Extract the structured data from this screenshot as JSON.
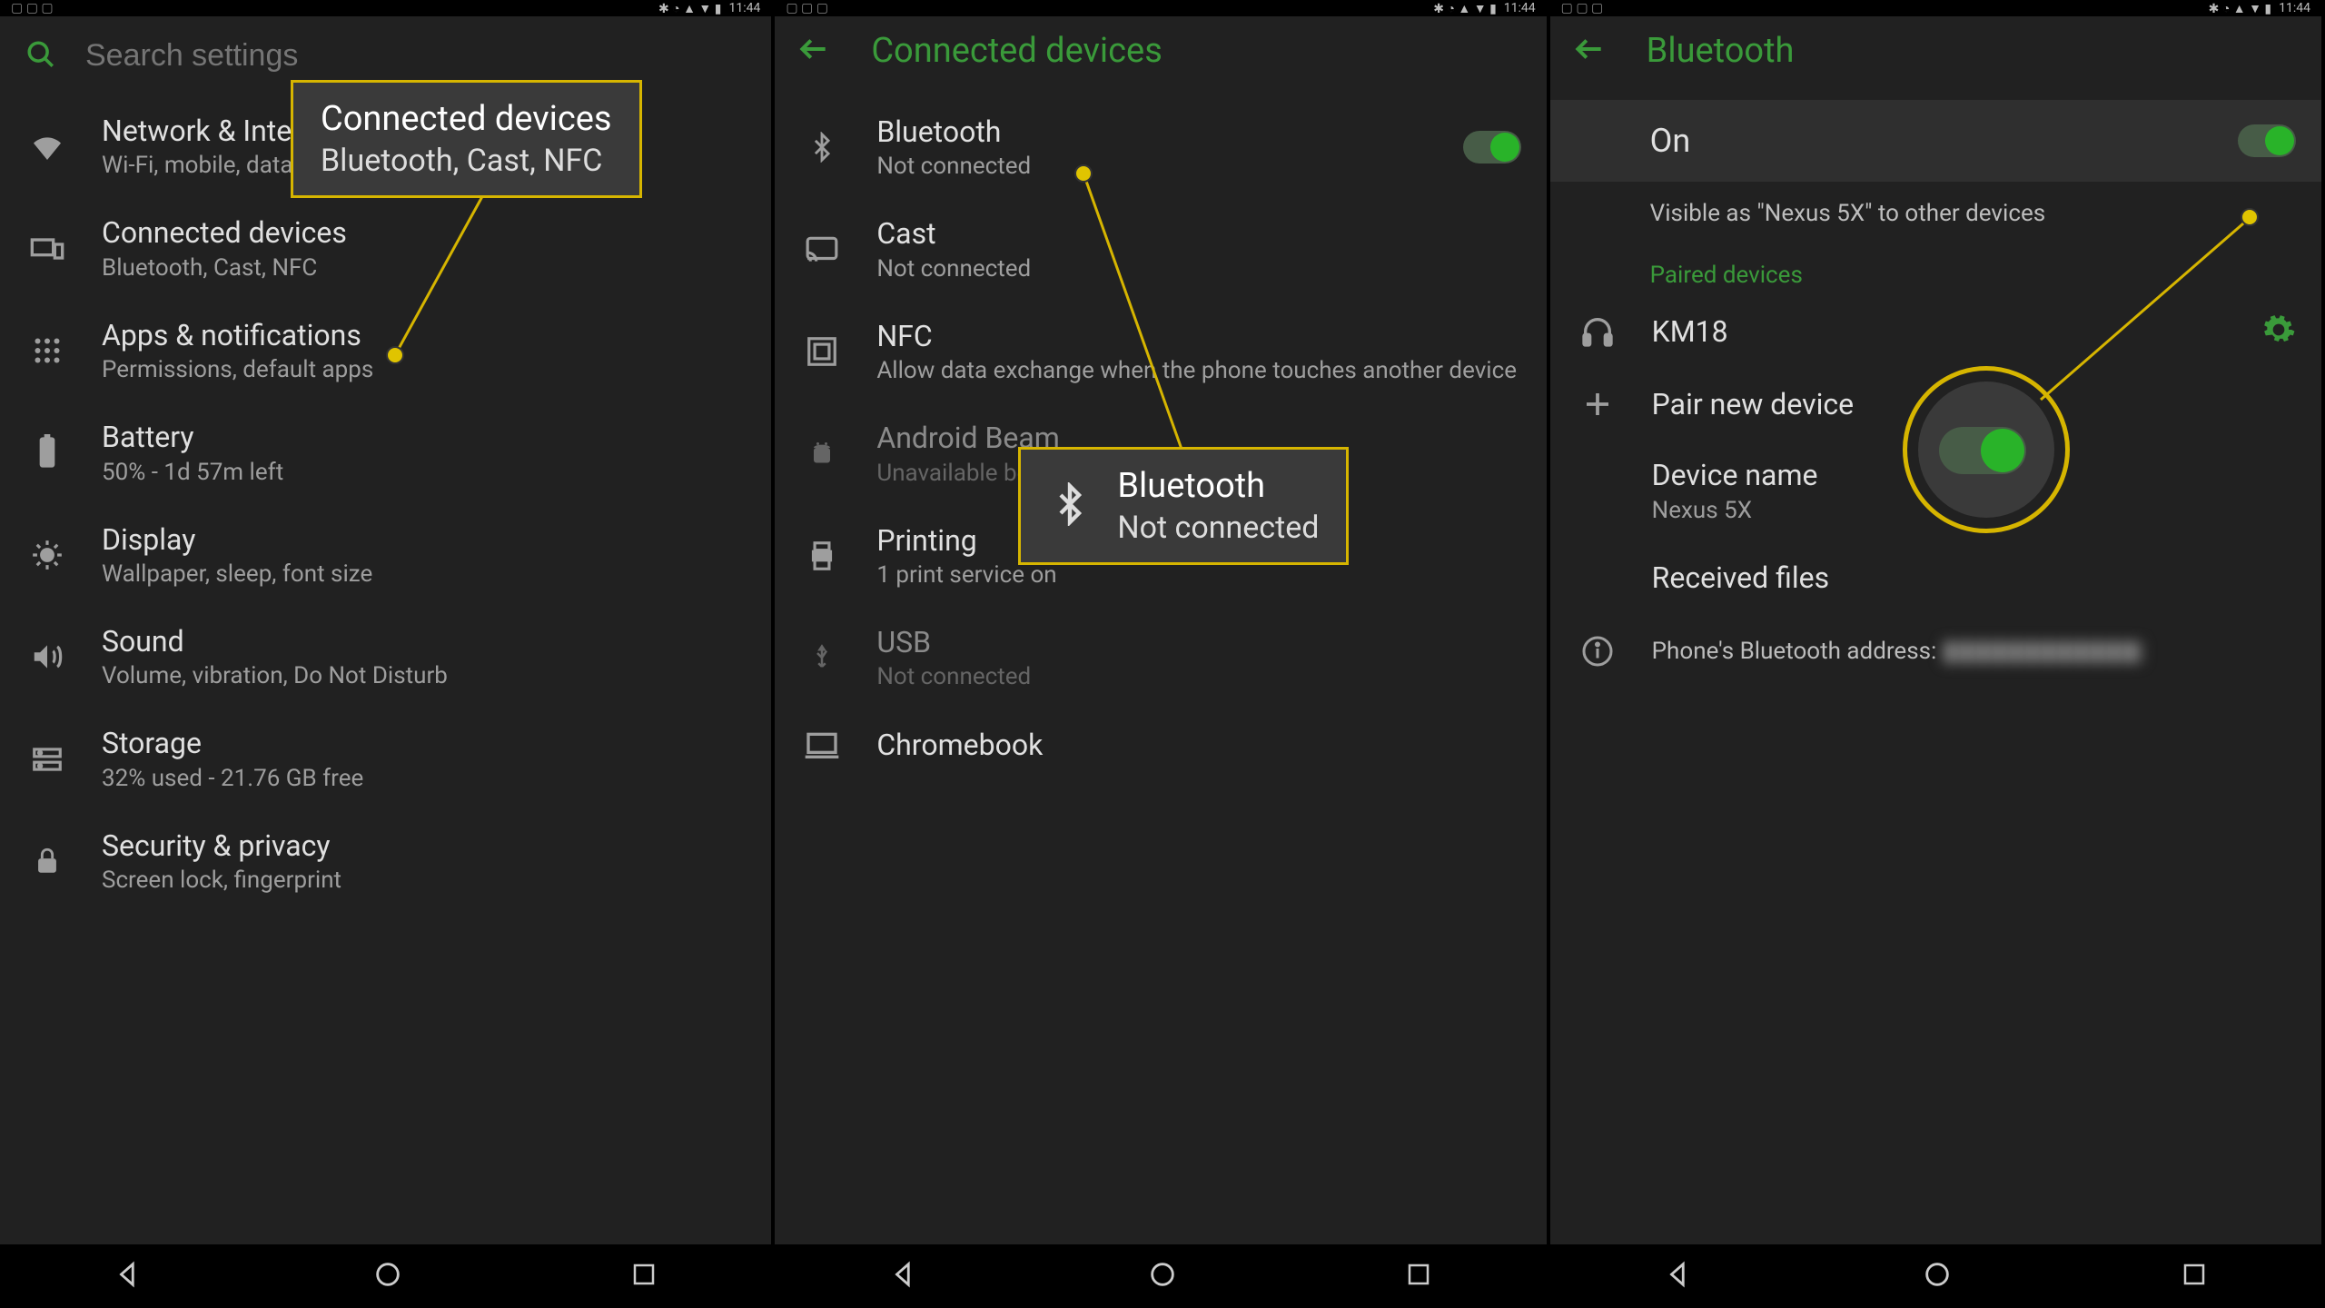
{
  "statusbar": {
    "time": "11:44"
  },
  "phone1": {
    "search_placeholder": "Search settings",
    "items": [
      {
        "title": "Network & Internet",
        "sub": "Wi-Fi, mobile, data usage, hotspot"
      },
      {
        "title": "Connected devices",
        "sub": "Bluetooth, Cast, NFC"
      },
      {
        "title": "Apps & notifications",
        "sub": "Permissions, default apps"
      },
      {
        "title": "Battery",
        "sub": "50% - 1d 57m left"
      },
      {
        "title": "Display",
        "sub": "Wallpaper, sleep, font size"
      },
      {
        "title": "Sound",
        "sub": "Volume, vibration, Do Not Disturb"
      },
      {
        "title": "Storage",
        "sub": "32% used - 21.76 GB free"
      },
      {
        "title": "Security & privacy",
        "sub": "Screen lock, fingerprint"
      }
    ],
    "callout": {
      "title": "Connected devices",
      "sub": "Bluetooth, Cast, NFC"
    }
  },
  "phone2": {
    "header": "Connected devices",
    "items": [
      {
        "title": "Bluetooth",
        "sub": "Not connected",
        "toggle": true
      },
      {
        "title": "Cast",
        "sub": "Not connected"
      },
      {
        "title": "NFC",
        "sub": "Allow data exchange when the phone touches another device"
      },
      {
        "title": "Android Beam",
        "sub": "Unavailable because NFC is turned off",
        "disabled": true
      },
      {
        "title": "Printing",
        "sub": "1 print service on"
      },
      {
        "title": "USB",
        "sub": "Not connected",
        "disabled": true
      },
      {
        "title": "Chromebook",
        "sub": ""
      }
    ],
    "callout": {
      "title": "Bluetooth",
      "sub": "Not connected"
    }
  },
  "phone3": {
    "header": "Bluetooth",
    "on_label": "On",
    "visible_note": "Visible as \"Nexus 5X\" to other devices",
    "section_paired": "Paired devices",
    "paired_device": "KM18",
    "pair_new": "Pair new device",
    "device_name_label": "Device name",
    "device_name_value": "Nexus 5X",
    "received_files": "Received files",
    "bt_address_label": "Phone's Bluetooth address: "
  }
}
